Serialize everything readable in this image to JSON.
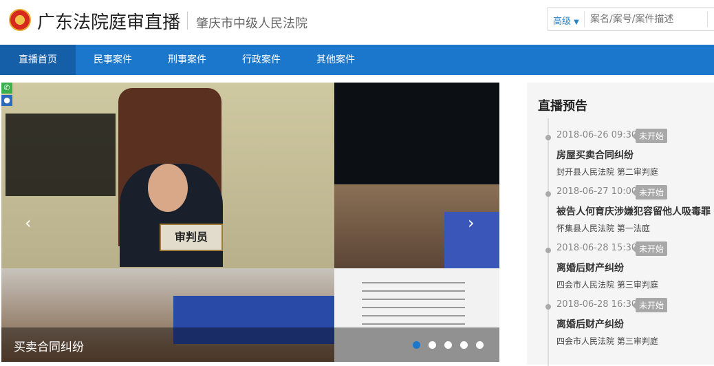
{
  "header": {
    "site_title": "广东法院庭审直播",
    "court_name": "肇庆市中级人民法院"
  },
  "search": {
    "advanced_label": "高级",
    "placeholder": "案名/案号/案件描述"
  },
  "nav": [
    {
      "label": "直播首页",
      "active": true
    },
    {
      "label": "民事案件"
    },
    {
      "label": "刑事案件"
    },
    {
      "label": "行政案件"
    },
    {
      "label": "其他案件"
    }
  ],
  "carousel": {
    "caption": "买卖合同纠纷",
    "nameplate": "审判员",
    "slide_count": 5,
    "active_slide": 1
  },
  "schedule": {
    "title": "直播预告",
    "items": [
      {
        "time": "2018-06-26 09:30",
        "status": "未开始",
        "case": "房屋买卖合同纠纷",
        "court": "封开县人民法院 第二审判庭"
      },
      {
        "time": "2018-06-27 10:00",
        "status": "未开始",
        "case": "被告人何育庆涉嫌犯容留他人吸毒罪",
        "court": "怀集县人民法院 第一法庭"
      },
      {
        "time": "2018-06-28 15:30",
        "status": "未开始",
        "case": "离婚后财产纠纷",
        "court": "四会市人民法院 第三审判庭"
      },
      {
        "time": "2018-06-28 16:30",
        "status": "未开始",
        "case": "离婚后财产纠纷",
        "court": "四会市人民法院 第三审判庭"
      }
    ]
  }
}
